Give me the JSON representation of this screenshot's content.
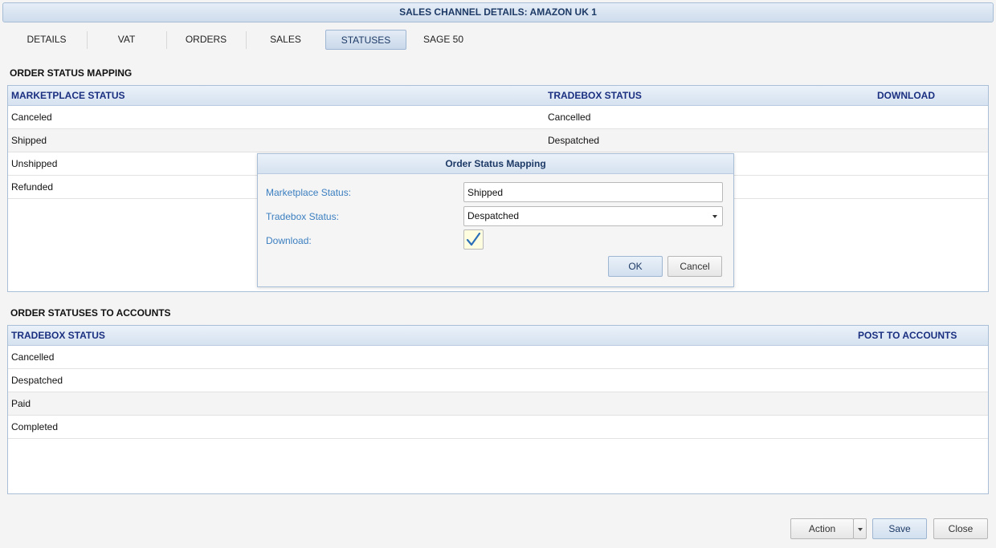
{
  "window": {
    "title": "SALES CHANNEL DETAILS: AMAZON UK 1"
  },
  "tabs": [
    {
      "label": "DETAILS"
    },
    {
      "label": "VAT"
    },
    {
      "label": "ORDERS"
    },
    {
      "label": "SALES"
    },
    {
      "label": "STATUSES",
      "active": true
    },
    {
      "label": "SAGE 50"
    }
  ],
  "status_mapping": {
    "title": "ORDER STATUS MAPPING",
    "columns": [
      "MARKETPLACE STATUS",
      "TRADEBOX STATUS",
      "DOWNLOAD"
    ],
    "rows": [
      {
        "marketplace": "Canceled",
        "tradebox": "Cancelled"
      },
      {
        "marketplace": "Shipped",
        "tradebox": "Despatched"
      },
      {
        "marketplace": "Unshipped",
        "tradebox": ""
      },
      {
        "marketplace": "Refunded",
        "tradebox": ""
      }
    ]
  },
  "accounts": {
    "title": "ORDER STATUSES TO ACCOUNTS",
    "columns": [
      "TRADEBOX STATUS",
      "POST TO ACCOUNTS"
    ],
    "rows": [
      {
        "status": "Cancelled"
      },
      {
        "status": "Despatched"
      },
      {
        "status": "Paid"
      },
      {
        "status": "Completed"
      }
    ]
  },
  "dialog": {
    "title": "Order Status Mapping",
    "marketplace_label": "Marketplace Status:",
    "marketplace_value": "Shipped",
    "tradebox_label": "Tradebox Status:",
    "tradebox_value": "Despatched",
    "download_label": "Download:",
    "download_checked": true,
    "ok_label": "OK",
    "cancel_label": "Cancel"
  },
  "footer": {
    "action_label": "Action",
    "save_label": "Save",
    "close_label": "Close"
  },
  "colors": {
    "header_text": "#1a2f80",
    "label_blue": "#3a7ec0",
    "check_blue": "#2a6fb8"
  }
}
